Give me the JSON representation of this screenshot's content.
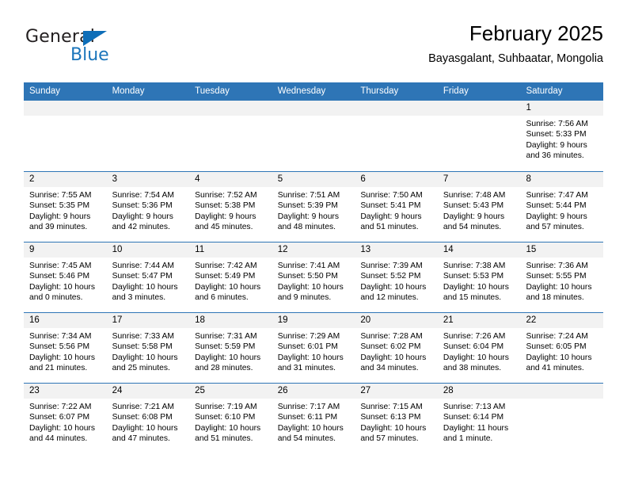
{
  "brand": {
    "word_one": "General",
    "word_two": "Blue",
    "accent_color": "#1b75bb"
  },
  "header": {
    "title": "February 2025",
    "subtitle": "Bayasgalant, Suhbaatar, Mongolia"
  },
  "calendar": {
    "header_color": "#2e75b6",
    "daynum_band_color": "#f2f2f2",
    "weekdays": [
      "Sunday",
      "Monday",
      "Tuesday",
      "Wednesday",
      "Thursday",
      "Friday",
      "Saturday"
    ],
    "weeks": [
      [
        {
          "day": "",
          "empty": true
        },
        {
          "day": "",
          "empty": true
        },
        {
          "day": "",
          "empty": true
        },
        {
          "day": "",
          "empty": true
        },
        {
          "day": "",
          "empty": true
        },
        {
          "day": "",
          "empty": true
        },
        {
          "day": "1",
          "sunrise": "Sunrise: 7:56 AM",
          "sunset": "Sunset: 5:33 PM",
          "daylight_1": "Daylight: 9 hours",
          "daylight_2": "and 36 minutes."
        }
      ],
      [
        {
          "day": "2",
          "sunrise": "Sunrise: 7:55 AM",
          "sunset": "Sunset: 5:35 PM",
          "daylight_1": "Daylight: 9 hours",
          "daylight_2": "and 39 minutes."
        },
        {
          "day": "3",
          "sunrise": "Sunrise: 7:54 AM",
          "sunset": "Sunset: 5:36 PM",
          "daylight_1": "Daylight: 9 hours",
          "daylight_2": "and 42 minutes."
        },
        {
          "day": "4",
          "sunrise": "Sunrise: 7:52 AM",
          "sunset": "Sunset: 5:38 PM",
          "daylight_1": "Daylight: 9 hours",
          "daylight_2": "and 45 minutes."
        },
        {
          "day": "5",
          "sunrise": "Sunrise: 7:51 AM",
          "sunset": "Sunset: 5:39 PM",
          "daylight_1": "Daylight: 9 hours",
          "daylight_2": "and 48 minutes."
        },
        {
          "day": "6",
          "sunrise": "Sunrise: 7:50 AM",
          "sunset": "Sunset: 5:41 PM",
          "daylight_1": "Daylight: 9 hours",
          "daylight_2": "and 51 minutes."
        },
        {
          "day": "7",
          "sunrise": "Sunrise: 7:48 AM",
          "sunset": "Sunset: 5:43 PM",
          "daylight_1": "Daylight: 9 hours",
          "daylight_2": "and 54 minutes."
        },
        {
          "day": "8",
          "sunrise": "Sunrise: 7:47 AM",
          "sunset": "Sunset: 5:44 PM",
          "daylight_1": "Daylight: 9 hours",
          "daylight_2": "and 57 minutes."
        }
      ],
      [
        {
          "day": "9",
          "sunrise": "Sunrise: 7:45 AM",
          "sunset": "Sunset: 5:46 PM",
          "daylight_1": "Daylight: 10 hours",
          "daylight_2": "and 0 minutes."
        },
        {
          "day": "10",
          "sunrise": "Sunrise: 7:44 AM",
          "sunset": "Sunset: 5:47 PM",
          "daylight_1": "Daylight: 10 hours",
          "daylight_2": "and 3 minutes."
        },
        {
          "day": "11",
          "sunrise": "Sunrise: 7:42 AM",
          "sunset": "Sunset: 5:49 PM",
          "daylight_1": "Daylight: 10 hours",
          "daylight_2": "and 6 minutes."
        },
        {
          "day": "12",
          "sunrise": "Sunrise: 7:41 AM",
          "sunset": "Sunset: 5:50 PM",
          "daylight_1": "Daylight: 10 hours",
          "daylight_2": "and 9 minutes."
        },
        {
          "day": "13",
          "sunrise": "Sunrise: 7:39 AM",
          "sunset": "Sunset: 5:52 PM",
          "daylight_1": "Daylight: 10 hours",
          "daylight_2": "and 12 minutes."
        },
        {
          "day": "14",
          "sunrise": "Sunrise: 7:38 AM",
          "sunset": "Sunset: 5:53 PM",
          "daylight_1": "Daylight: 10 hours",
          "daylight_2": "and 15 minutes."
        },
        {
          "day": "15",
          "sunrise": "Sunrise: 7:36 AM",
          "sunset": "Sunset: 5:55 PM",
          "daylight_1": "Daylight: 10 hours",
          "daylight_2": "and 18 minutes."
        }
      ],
      [
        {
          "day": "16",
          "sunrise": "Sunrise: 7:34 AM",
          "sunset": "Sunset: 5:56 PM",
          "daylight_1": "Daylight: 10 hours",
          "daylight_2": "and 21 minutes."
        },
        {
          "day": "17",
          "sunrise": "Sunrise: 7:33 AM",
          "sunset": "Sunset: 5:58 PM",
          "daylight_1": "Daylight: 10 hours",
          "daylight_2": "and 25 minutes."
        },
        {
          "day": "18",
          "sunrise": "Sunrise: 7:31 AM",
          "sunset": "Sunset: 5:59 PM",
          "daylight_1": "Daylight: 10 hours",
          "daylight_2": "and 28 minutes."
        },
        {
          "day": "19",
          "sunrise": "Sunrise: 7:29 AM",
          "sunset": "Sunset: 6:01 PM",
          "daylight_1": "Daylight: 10 hours",
          "daylight_2": "and 31 minutes."
        },
        {
          "day": "20",
          "sunrise": "Sunrise: 7:28 AM",
          "sunset": "Sunset: 6:02 PM",
          "daylight_1": "Daylight: 10 hours",
          "daylight_2": "and 34 minutes."
        },
        {
          "day": "21",
          "sunrise": "Sunrise: 7:26 AM",
          "sunset": "Sunset: 6:04 PM",
          "daylight_1": "Daylight: 10 hours",
          "daylight_2": "and 38 minutes."
        },
        {
          "day": "22",
          "sunrise": "Sunrise: 7:24 AM",
          "sunset": "Sunset: 6:05 PM",
          "daylight_1": "Daylight: 10 hours",
          "daylight_2": "and 41 minutes."
        }
      ],
      [
        {
          "day": "23",
          "sunrise": "Sunrise: 7:22 AM",
          "sunset": "Sunset: 6:07 PM",
          "daylight_1": "Daylight: 10 hours",
          "daylight_2": "and 44 minutes."
        },
        {
          "day": "24",
          "sunrise": "Sunrise: 7:21 AM",
          "sunset": "Sunset: 6:08 PM",
          "daylight_1": "Daylight: 10 hours",
          "daylight_2": "and 47 minutes."
        },
        {
          "day": "25",
          "sunrise": "Sunrise: 7:19 AM",
          "sunset": "Sunset: 6:10 PM",
          "daylight_1": "Daylight: 10 hours",
          "daylight_2": "and 51 minutes."
        },
        {
          "day": "26",
          "sunrise": "Sunrise: 7:17 AM",
          "sunset": "Sunset: 6:11 PM",
          "daylight_1": "Daylight: 10 hours",
          "daylight_2": "and 54 minutes."
        },
        {
          "day": "27",
          "sunrise": "Sunrise: 7:15 AM",
          "sunset": "Sunset: 6:13 PM",
          "daylight_1": "Daylight: 10 hours",
          "daylight_2": "and 57 minutes."
        },
        {
          "day": "28",
          "sunrise": "Sunrise: 7:13 AM",
          "sunset": "Sunset: 6:14 PM",
          "daylight_1": "Daylight: 11 hours",
          "daylight_2": "and 1 minute."
        },
        {
          "day": "",
          "empty": true
        }
      ]
    ]
  }
}
